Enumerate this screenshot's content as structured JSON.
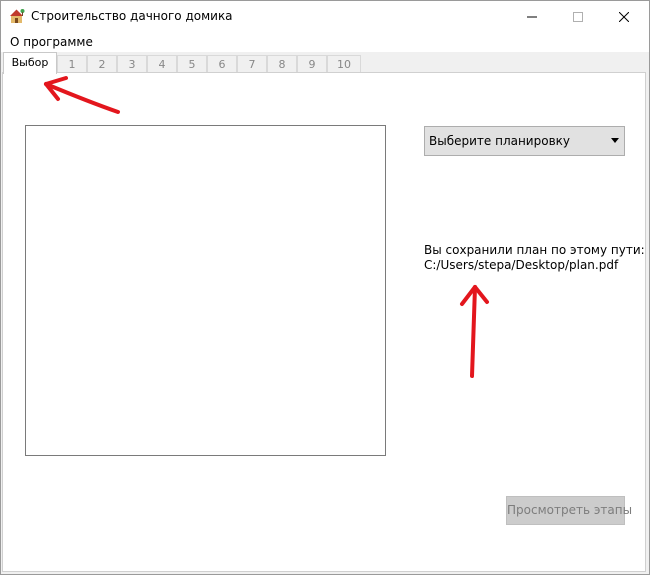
{
  "window": {
    "title": "Строительство дачного домика",
    "icon": "house-icon"
  },
  "menu": {
    "items": [
      {
        "label": "О программе"
      }
    ]
  },
  "tabs": [
    {
      "label": "Выбор",
      "active": true
    },
    {
      "label": "1"
    },
    {
      "label": "2"
    },
    {
      "label": "3"
    },
    {
      "label": "4"
    },
    {
      "label": "5"
    },
    {
      "label": "6"
    },
    {
      "label": "7"
    },
    {
      "label": "8"
    },
    {
      "label": "9"
    },
    {
      "label": "10"
    }
  ],
  "main": {
    "layout_select": {
      "value": "Выберите планировку"
    },
    "saved_message_line1": "Вы сохранили план по этому пути:",
    "saved_message_line2": "C:/Users/stepa/Desktop/plan.pdf",
    "view_stages_button": "Просмотреть этапы"
  },
  "colors": {
    "annotation_arrow": "#e3161d",
    "disabled_button_bg": "#cccccc"
  }
}
